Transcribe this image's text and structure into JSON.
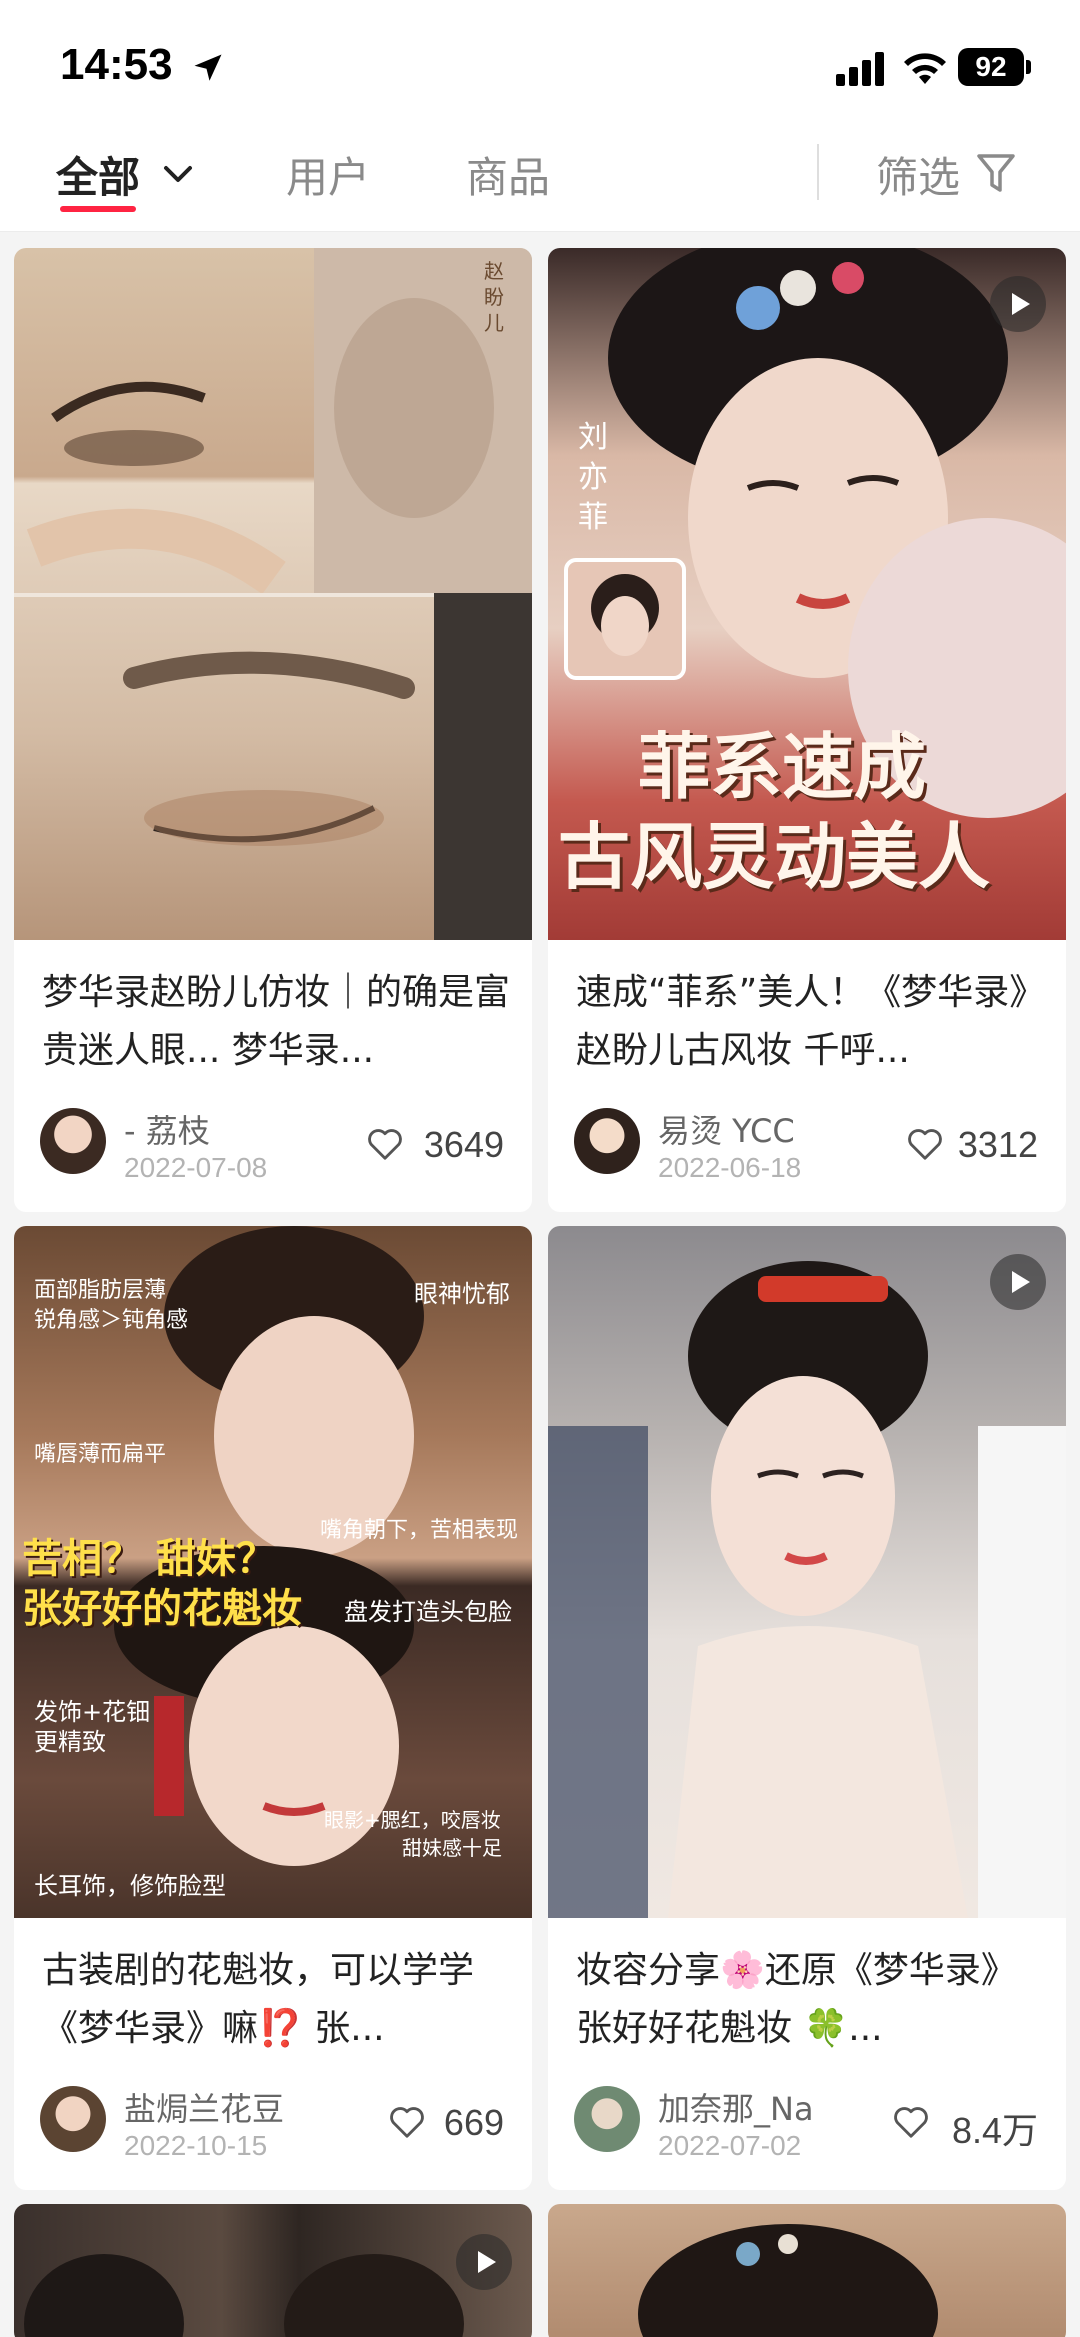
{
  "status": {
    "time": "14:53",
    "battery": "92"
  },
  "tabs": {
    "all": "全部",
    "users": "用户",
    "goods": "商品",
    "filter": "筛选"
  },
  "cards": [
    {
      "title": "梦华录赵盼儿仿妆｜的确是富贵迷人眼... 梦华录...",
      "author": "- 荔枝",
      "date": "2022-07-08",
      "likes": "3649",
      "image_text": [
        "赵盼儿"
      ]
    },
    {
      "title": "速成“菲系”美人！《梦华录》赵盼儿古风妆 千呼...",
      "author": "易烫 YCC",
      "date": "2022-06-18",
      "likes": "3312",
      "image_text": [
        "刘亦菲",
        "菲系速成",
        "古风灵动美人"
      ]
    },
    {
      "title": "古装剧的花魁妆，可以学学《梦华录》嘛⁉️ 张...",
      "author": "盐焗兰花豆",
      "date": "2022-10-15",
      "likes": "669",
      "image_text": [
        "面部脂肪层薄",
        "锐角感＞钝角感",
        "眼神忧郁",
        "嘴唇薄而扁平",
        "嘴角朝下，苦相表现",
        "苦相？ 甜妹？",
        "张好好的花魁妆",
        "盘发打造头包脸",
        "发饰+花钿",
        "更精致",
        "眼影+腮红，咬唇妆",
        "甜妹感十足",
        "长耳饰，修饰脸型"
      ]
    },
    {
      "title": "妆容分享🌸还原《梦华录》张好好花魁妆 🍀...",
      "author": "加奈那_Na",
      "date": "2022-07-02",
      "likes": "8.4万"
    }
  ],
  "colors": {
    "accent": "#ff2442"
  }
}
